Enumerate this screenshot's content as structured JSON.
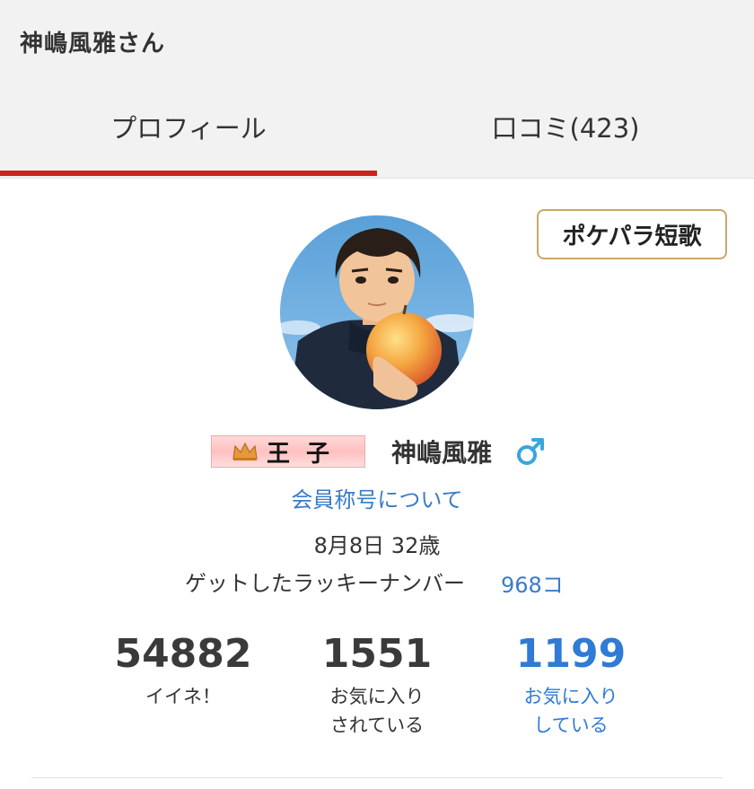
{
  "header": {
    "title": "神嶋風雅さん"
  },
  "tabs": [
    {
      "label": "プロフィール",
      "active": true
    },
    {
      "label": "口コミ(423)",
      "active": false
    }
  ],
  "colors": {
    "accent": "#c9241d",
    "link": "#3a7bc8",
    "gold_border": "#c9a76a"
  },
  "tanka_button": {
    "label": "ポケパラ短歌"
  },
  "profile": {
    "rank": {
      "icon": "crown-icon",
      "label": "王子"
    },
    "name": "神嶋風雅",
    "gender_icon": "male-icon",
    "rank_link": "会員称号について",
    "birthday": "8月8日 32歳",
    "lucky_label": "ゲットしたラッキーナンバー",
    "lucky_value": "968コ"
  },
  "stats": [
    {
      "value": "54882",
      "label": "イイネ！"
    },
    {
      "value": "1551",
      "label": "お気に入り\nされている"
    },
    {
      "value": "1199",
      "label": "お気に入り\nしている"
    }
  ]
}
